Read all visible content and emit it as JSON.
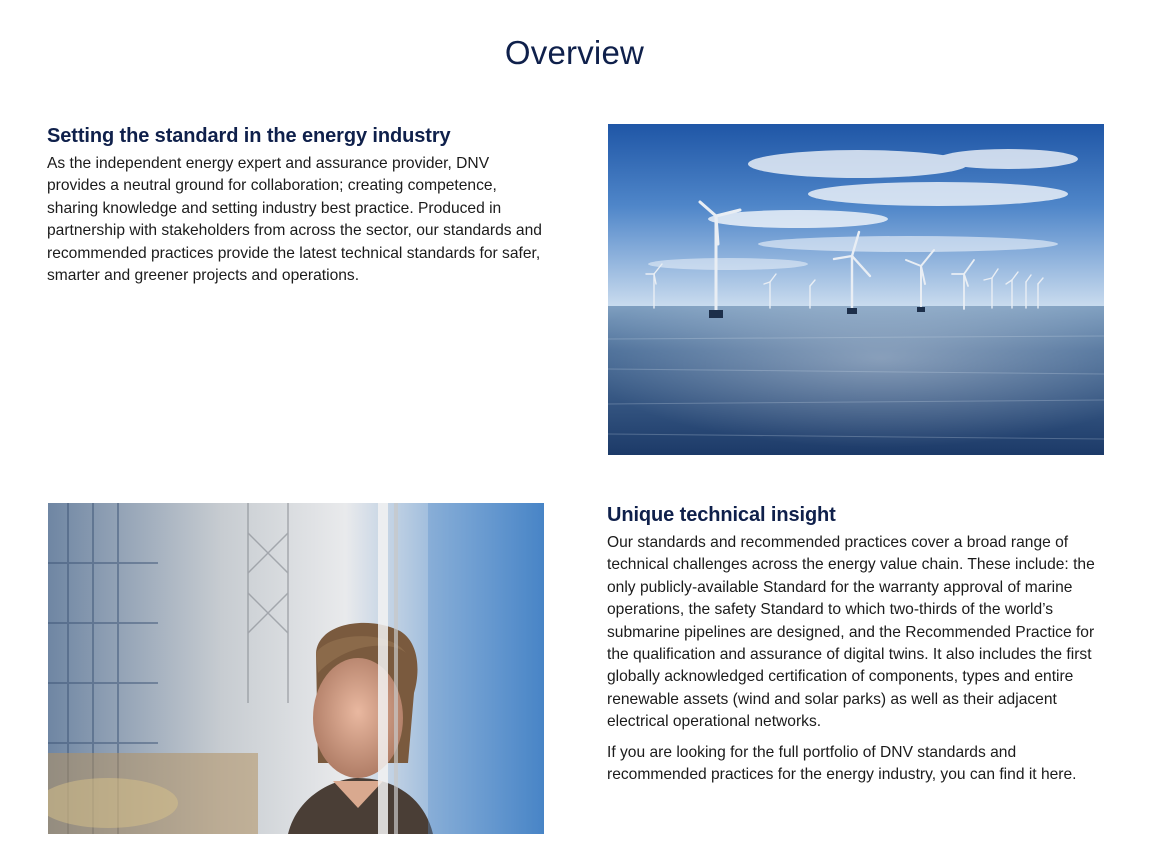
{
  "page": {
    "title": "Overview"
  },
  "section_1": {
    "heading": "Setting the standard in the energy industry",
    "body": "As the independent energy expert and assurance provider, DNV provides a neutral ground for collaboration; creating competence, sharing knowledge and setting industry best practice. Produced in partnership with stakeholders from across the sector, our standards and recommended practices provide the latest technical standards for safer, smarter and greener projects and operations."
  },
  "section_2": {
    "heading": "Unique technical insight",
    "body_1": "Our standards and recommended practices cover a broad range of technical challenges across the energy value chain. These include: the only publicly-available Standard for the warranty approval of marine operations, the safety Standard to which two-thirds of the world’s submarine pipelines are designed, and the Recommended Practice for the qualification and assurance of digital twins. It also includes the first globally acknowledged certification of components, types and entire renewable assets (wind and solar parks) as well as their adjacent electrical operational networks.",
    "body_2_prefix": "If you are looking for the full portfolio of DNV standards and recommended practices for the energy industry, you can find it ",
    "body_2_link": "here",
    "body_2_suffix": "."
  },
  "images": {
    "wind_farm": {
      "icon": "offshore-wind-turbines-photo"
    },
    "engineer": {
      "icon": "woman-engineer-photo"
    }
  },
  "colors": {
    "heading": "#0f204b",
    "body_text": "#1b1b1b"
  }
}
